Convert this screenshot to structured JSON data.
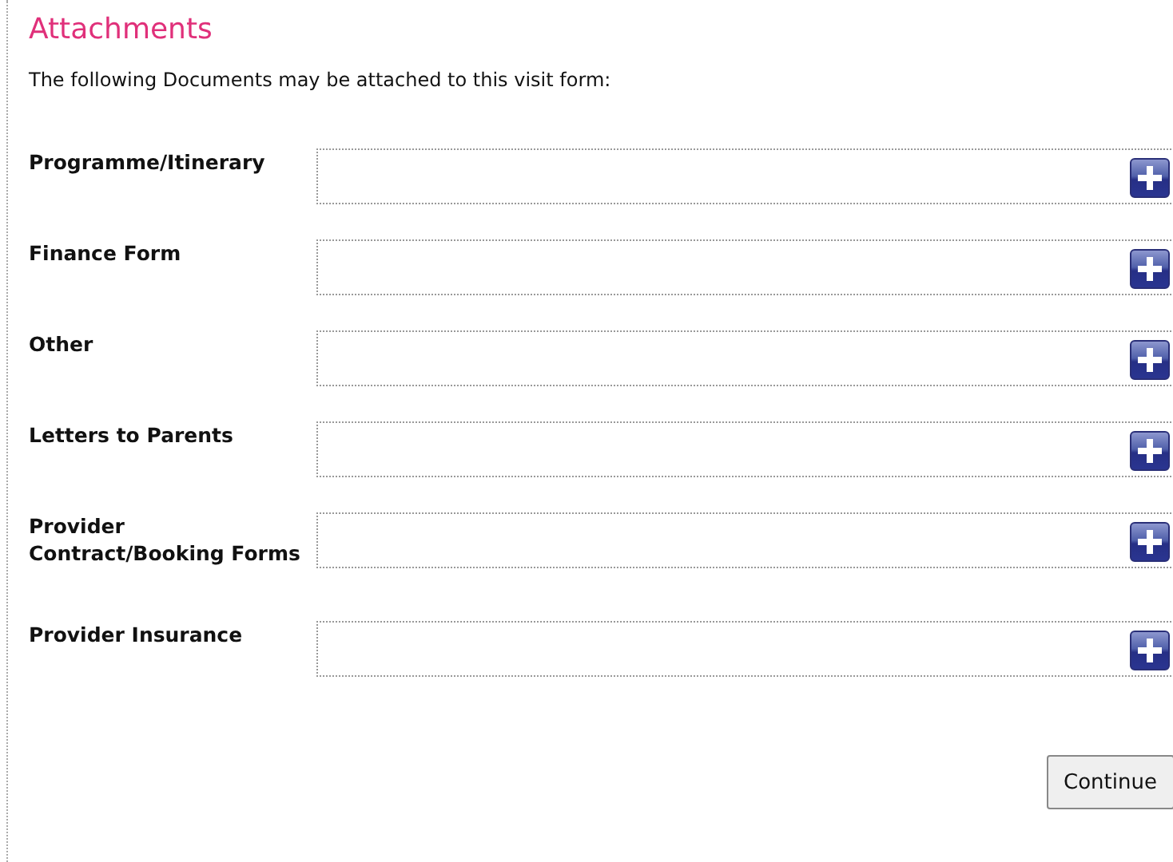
{
  "heading": "Attachments",
  "intro": "The following Documents may be attached to this visit form:",
  "attachments": [
    {
      "label": "Programme/Itinerary"
    },
    {
      "label": "Finance Form"
    },
    {
      "label": "Other"
    },
    {
      "label": "Letters to Parents"
    },
    {
      "label": "Provider Contract/Booking Forms"
    },
    {
      "label": "Provider Insurance"
    }
  ],
  "continue_button": "Continue"
}
